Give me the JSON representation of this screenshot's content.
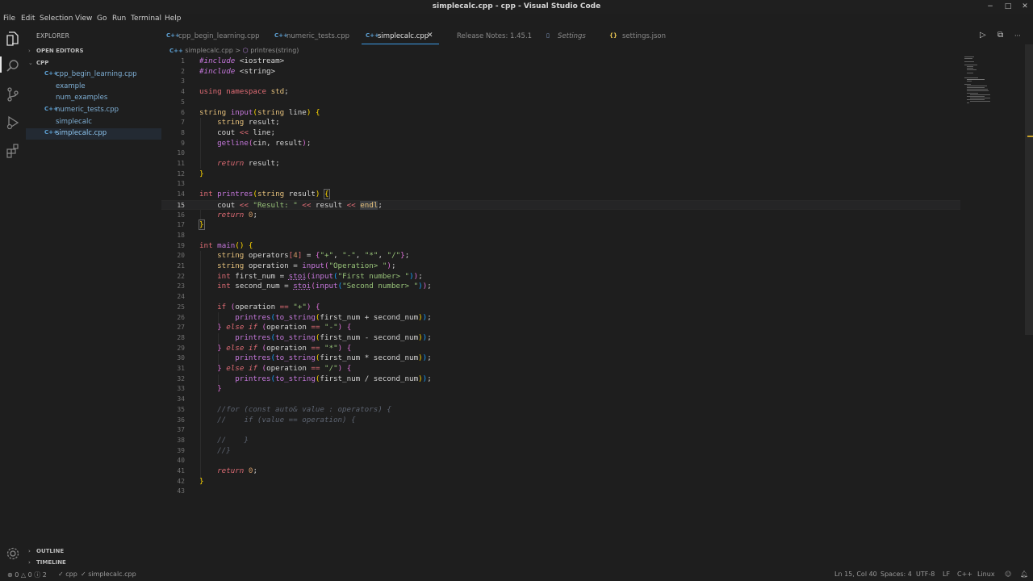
{
  "window": {
    "title": "simplecalc.cpp - cpp - Visual Studio Code",
    "controls": [
      "−",
      "□",
      "✕"
    ]
  },
  "menu": [
    "File",
    "Edit",
    "Selection",
    "View",
    "Go",
    "Run",
    "Terminal",
    "Help"
  ],
  "activity_bar": [
    "files-icon",
    "search-icon",
    "source-control-icon",
    "run-debug-icon",
    "extensions-icon",
    "manage-gear-icon"
  ],
  "sidebar": {
    "title": "EXPLORER",
    "open_editors": "OPEN EDITORS",
    "folder": "CPP",
    "files": [
      {
        "name": "cpp_begin_learning.cpp",
        "icon": "C++"
      },
      {
        "name": "example",
        "icon": ""
      },
      {
        "name": "num_examples",
        "icon": ""
      },
      {
        "name": "numeric_tests.cpp",
        "icon": "C++"
      },
      {
        "name": "simplecalc",
        "icon": ""
      },
      {
        "name": "simplecalc.cpp",
        "icon": "C++"
      }
    ],
    "outline": "OUTLINE",
    "timeline": "TIMELINE"
  },
  "tabs": [
    {
      "label": "cpp_begin_learning.cpp",
      "icon": "C++"
    },
    {
      "label": "numeric_tests.cpp",
      "icon": "C++"
    },
    {
      "label": "simplecalc.cpp",
      "icon": "C++",
      "close": "✕"
    },
    {
      "label": "Release Notes: 1.45.1",
      "icon": ""
    },
    {
      "label": "Settings",
      "icon": "📄"
    },
    {
      "label": "settings.json",
      "icon": "{}"
    }
  ],
  "editor_actions": [
    "▷",
    "⧉",
    "···"
  ],
  "breadcrumb": {
    "file": "simplecalc.cpp",
    "separator": ">",
    "symbol": "printres(string)"
  },
  "code": {
    "current_line": 15,
    "line_count": 43
  },
  "status": {
    "errors": "0",
    "warnings": "0",
    "info": "2",
    "workspace": "cpp",
    "file": "simplecalc.cpp",
    "position": "Ln 15, Col 40",
    "spaces": "Spaces: 4",
    "encoding": "UTF-8",
    "eol": "LF",
    "language": "C++",
    "platform": "Linux"
  },
  "colors": {
    "background": "#1e1e1e",
    "accent": "#3c9be6",
    "file_text": "#7fb0d6"
  }
}
